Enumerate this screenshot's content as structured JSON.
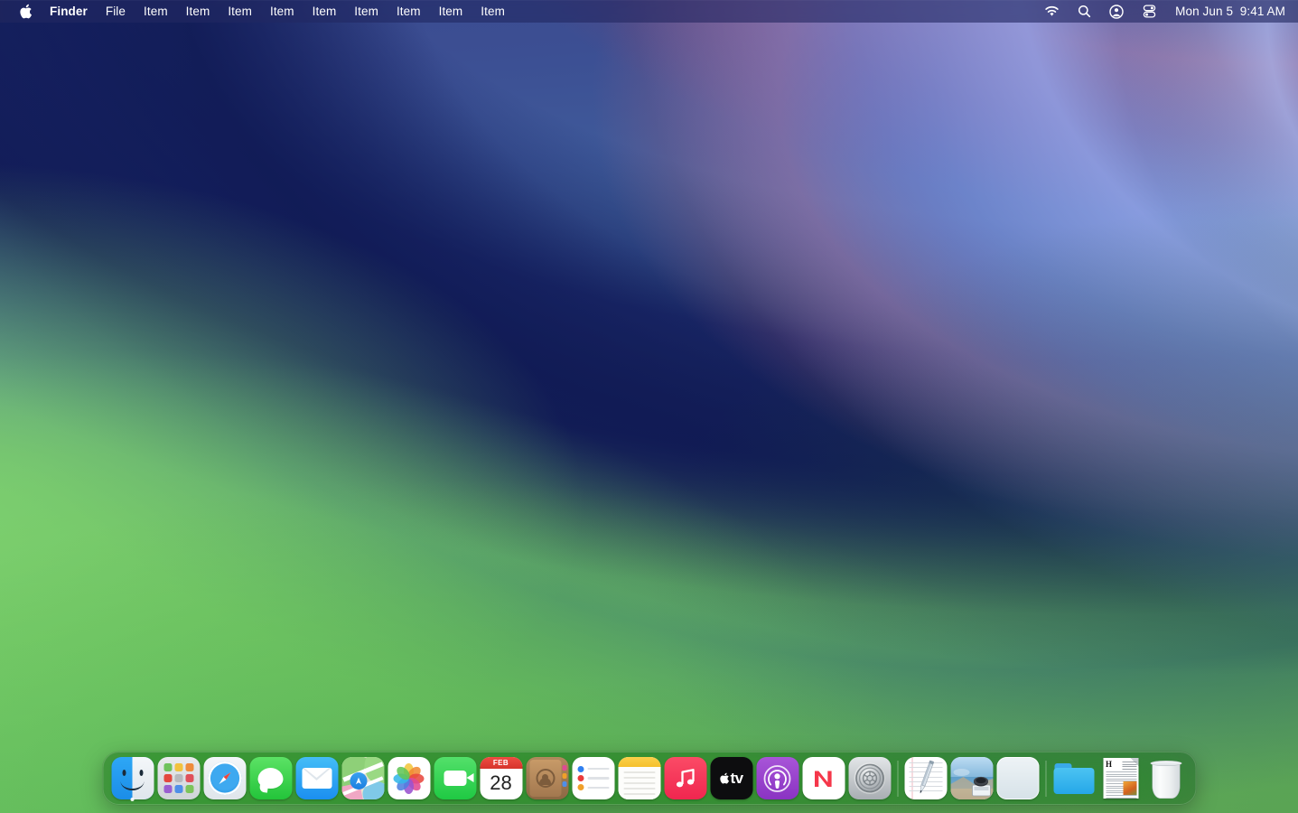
{
  "menubar": {
    "apple_icon": "apple-logo-icon",
    "items": [
      {
        "label": "Finder",
        "bold": true
      },
      {
        "label": "File",
        "bold": false
      },
      {
        "label": "Item",
        "bold": false
      },
      {
        "label": "Item",
        "bold": false
      },
      {
        "label": "Item",
        "bold": false
      },
      {
        "label": "Item",
        "bold": false
      },
      {
        "label": "Item",
        "bold": false
      },
      {
        "label": "Item",
        "bold": false
      },
      {
        "label": "Item",
        "bold": false
      },
      {
        "label": "Item",
        "bold": false
      },
      {
        "label": "Item",
        "bold": false
      }
    ],
    "status_icons": [
      {
        "name": "wifi-icon"
      },
      {
        "name": "search-icon"
      },
      {
        "name": "control-center-user-icon"
      },
      {
        "name": "control-center-icon"
      }
    ],
    "clock": "Mon Jun 5  9:41 AM",
    "date_text": "Mon Jun 5",
    "time_text": "9:41 AM",
    "background_color": "#24285a",
    "text_color": "#ffffff"
  },
  "desktop": {
    "wallpaper_name": "macos-ventura-waves",
    "wallpaper_colors": {
      "navy": "#141e5f",
      "indigo": "#3a4a8f",
      "mauve": "#96547a",
      "periwinkle": "#98a8ee",
      "teal": "#30607c",
      "green_light": "#80d670",
      "green": "#6fba5e",
      "green_dark": "#46964a"
    }
  },
  "dock": {
    "background_color": "#1e4c22",
    "running_indicator_color": "#ffffff",
    "items": [
      {
        "name": "dock-item-finder",
        "label": "Finder",
        "running": true,
        "type": "app"
      },
      {
        "name": "dock-item-launchpad",
        "label": "Launchpad",
        "running": false,
        "type": "app"
      },
      {
        "name": "dock-item-safari",
        "label": "Safari",
        "running": false,
        "type": "app"
      },
      {
        "name": "dock-item-messages",
        "label": "Messages",
        "running": false,
        "type": "app"
      },
      {
        "name": "dock-item-mail",
        "label": "Mail",
        "running": false,
        "type": "app"
      },
      {
        "name": "dock-item-maps",
        "label": "Maps",
        "running": false,
        "type": "app"
      },
      {
        "name": "dock-item-photos",
        "label": "Photos",
        "running": false,
        "type": "app"
      },
      {
        "name": "dock-item-facetime",
        "label": "FaceTime",
        "running": false,
        "type": "app"
      },
      {
        "name": "dock-item-calendar",
        "label": "Calendar",
        "running": false,
        "type": "app",
        "month": "FEB",
        "day": "28"
      },
      {
        "name": "dock-item-contacts",
        "label": "Contacts",
        "running": false,
        "type": "app"
      },
      {
        "name": "dock-item-reminders",
        "label": "Reminders",
        "running": false,
        "type": "app"
      },
      {
        "name": "dock-item-notes",
        "label": "Notes",
        "running": false,
        "type": "app"
      },
      {
        "name": "dock-item-music",
        "label": "Music",
        "running": false,
        "type": "app"
      },
      {
        "name": "dock-item-tv",
        "label": "TV",
        "running": false,
        "type": "app",
        "wordmark": "tv"
      },
      {
        "name": "dock-item-podcasts",
        "label": "Podcasts",
        "running": false,
        "type": "app"
      },
      {
        "name": "dock-item-news",
        "label": "News",
        "running": false,
        "type": "app",
        "wordmark": "N"
      },
      {
        "name": "dock-item-system-settings",
        "label": "System Settings",
        "running": false,
        "type": "app"
      },
      {
        "name": "dock-separator-1",
        "label": "",
        "running": false,
        "type": "separator"
      },
      {
        "name": "dock-item-textedit",
        "label": "TextEdit",
        "running": false,
        "type": "app"
      },
      {
        "name": "dock-item-preview",
        "label": "Preview",
        "running": false,
        "type": "app"
      },
      {
        "name": "dock-item-blank-app",
        "label": "App",
        "running": false,
        "type": "app"
      },
      {
        "name": "dock-separator-2",
        "label": "",
        "running": false,
        "type": "separator"
      },
      {
        "name": "dock-item-downloads-folder",
        "label": "Downloads",
        "running": false,
        "type": "folder"
      },
      {
        "name": "dock-item-document",
        "label": "Document",
        "running": false,
        "type": "document",
        "heading": "H"
      },
      {
        "name": "dock-item-trash",
        "label": "Trash",
        "running": false,
        "type": "trash"
      }
    ],
    "calendar": {
      "month": "FEB",
      "day": "28"
    },
    "launchpad_tile_colors": [
      "#6fc25c",
      "#f2c23e",
      "#ef8b3c",
      "#e4473e",
      "#b7b9bd",
      "#e0505a",
      "#9a5fd0",
      "#4f8fe8",
      "#7cc45a"
    ],
    "reminders_dot_colors": [
      "#2f7ff0",
      "#ea3b3b",
      "#f0a02a"
    ]
  }
}
